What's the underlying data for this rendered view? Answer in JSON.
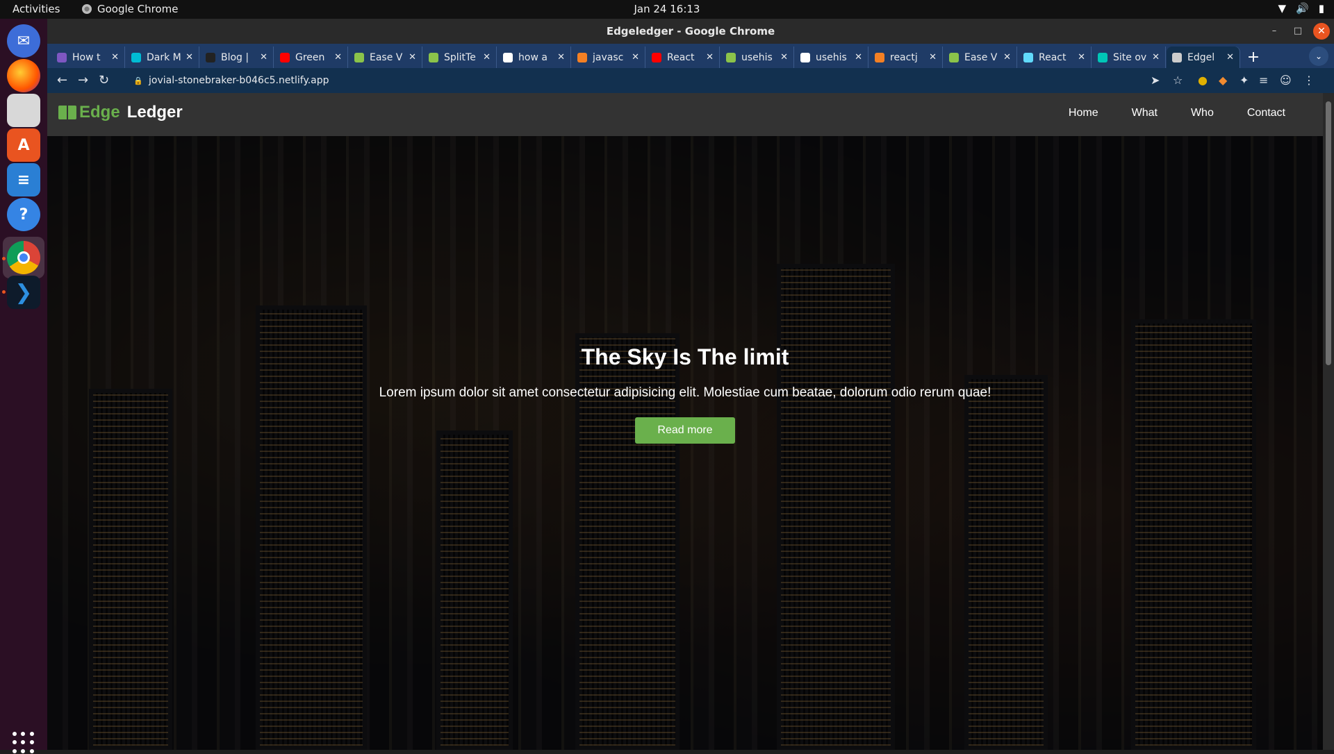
{
  "topbar": {
    "activities": "Activities",
    "app": "Google Chrome",
    "clock": "Jan 24  16:13"
  },
  "window": {
    "title": "Edgeledger - Google Chrome"
  },
  "tabs": [
    {
      "label": "How t",
      "color": "#7e57c2"
    },
    {
      "label": "Dark M",
      "color": "#00bcd4"
    },
    {
      "label": "Blog |",
      "color": "#222222"
    },
    {
      "label": "Green",
      "color": "#ff0000"
    },
    {
      "label": "Ease V",
      "color": "#8bc34a"
    },
    {
      "label": "SplitTe",
      "color": "#8bc34a"
    },
    {
      "label": "how a",
      "color": "#ffffff"
    },
    {
      "label": "javasc",
      "color": "#f48024"
    },
    {
      "label": "React",
      "color": "#ff0000"
    },
    {
      "label": "usehis",
      "color": "#8bc34a"
    },
    {
      "label": "usehis",
      "color": "#ffffff"
    },
    {
      "label": "reactj",
      "color": "#f48024"
    },
    {
      "label": "Ease V",
      "color": "#8bc34a"
    },
    {
      "label": "React",
      "color": "#61dafb"
    },
    {
      "label": "Site ov",
      "color": "#00c7b7"
    },
    {
      "label": "Edgel",
      "color": "#cccccc",
      "active": true
    }
  ],
  "address": {
    "url": "jovial-stonebraker-b046c5.netlify.app"
  },
  "site": {
    "brand_edge": "Edge",
    "brand_ledger": "Ledger",
    "nav": [
      "Home",
      "What",
      "Who",
      "Contact"
    ],
    "hero_title": "The Sky Is The limit",
    "hero_text": "Lorem ipsum dolor sit amet consectetur adipisicing elit. Molestiae cum beatae, dolorum odio rerum quae!",
    "hero_button": "Read more",
    "accent": "#6ab04c"
  },
  "dock_icons": [
    "thunderbird-icon",
    "firefox-icon",
    "files-icon",
    "software-icon",
    "writer-icon",
    "help-icon",
    "chrome-icon",
    "vscode-icon"
  ]
}
